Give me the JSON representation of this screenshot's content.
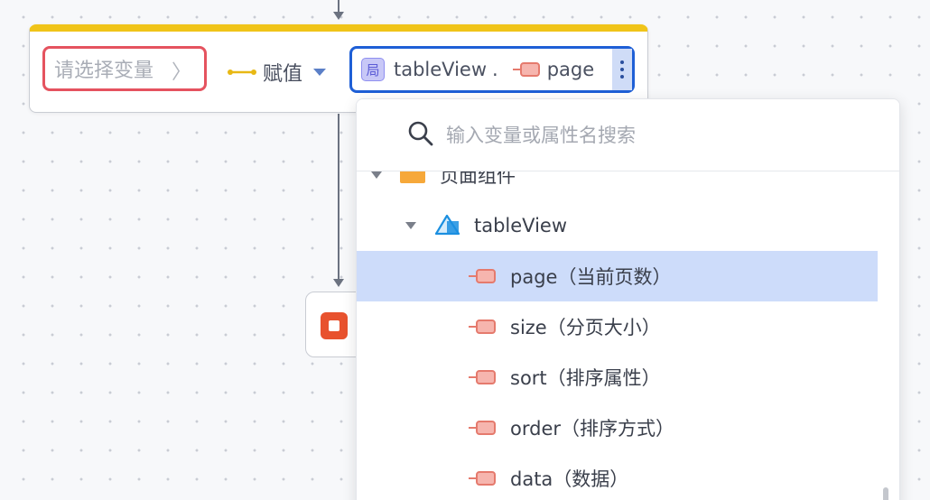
{
  "canvas": {
    "dot_color": "#c9ccd4",
    "background": "#f7f8fa"
  },
  "assign_node": {
    "accent_color": "#f0c419",
    "variable_select": {
      "placeholder": "请选择变量",
      "chevron_icon": "chevron-right-icon",
      "border_color": "#e5535f"
    },
    "operator": {
      "label": "赋值",
      "icon": "two-way-arrow-icon",
      "dropdown_icon": "caret-down-icon"
    },
    "value": {
      "scope_badge": "局",
      "component": "tableView",
      "separator": ".",
      "property_icon": "property-icon",
      "property": "page",
      "more_icon": "more-vertical-icon",
      "border_color": "#1e5fd6"
    }
  },
  "end_node": {
    "icon": "stop-icon",
    "color": "#e8522e"
  },
  "dropdown": {
    "search": {
      "placeholder": "输入变量或属性名搜索",
      "icon": "search-icon"
    },
    "tree": {
      "group": {
        "label": "页面组件",
        "icon": "folder-icon",
        "expanded": true
      },
      "component": {
        "label": "tableView",
        "icon": "table-view-icon",
        "expanded": true
      },
      "properties": [
        {
          "label": "page（当前页数）",
          "selected": true
        },
        {
          "label": "size（分页大小）",
          "selected": false
        },
        {
          "label": "sort（排序属性）",
          "selected": false
        },
        {
          "label": "order（排序方式）",
          "selected": false
        },
        {
          "label": "data（数据）",
          "selected": false
        }
      ]
    },
    "selected_color": "#cddcfa"
  }
}
